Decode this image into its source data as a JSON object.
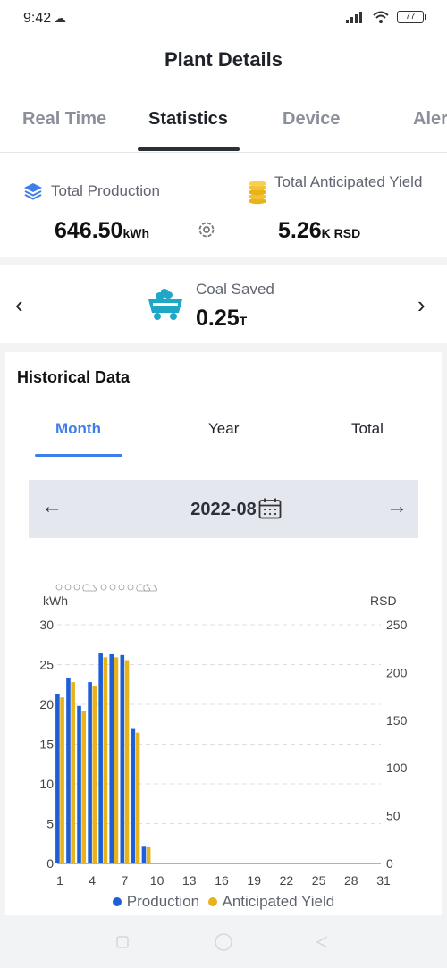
{
  "status": {
    "time": "9:42",
    "battery": "77"
  },
  "header": {
    "title": "Plant Details"
  },
  "tabs": [
    "Real Time",
    "Statistics",
    "Device",
    "Aler"
  ],
  "kpi": {
    "production": {
      "label": "Total Production",
      "value": "646.50",
      "unit": "kWh"
    },
    "yield": {
      "label": "Total Anticipated Yield",
      "value": "5.26",
      "unit": "K RSD"
    }
  },
  "coal": {
    "label": "Coal Saved",
    "value": "0.25",
    "unit": "T"
  },
  "historical": {
    "title": "Historical Data",
    "segments": [
      "Month",
      "Year",
      "Total"
    ],
    "date": "2022-08"
  },
  "colors": {
    "production": "#1f5fd6",
    "yield": "#e7b21a",
    "accent": "#3f7ee8"
  },
  "chart_data": {
    "type": "bar",
    "x": [
      1,
      2,
      3,
      4,
      5,
      6,
      7,
      8,
      9
    ],
    "x_ticks": [
      "1",
      "4",
      "7",
      "10",
      "13",
      "16",
      "19",
      "22",
      "25",
      "28",
      "31"
    ],
    "xlim": [
      1,
      31
    ],
    "left_axis": {
      "unit": "kWh",
      "ticks": [
        "0",
        "5",
        "10",
        "15",
        "20",
        "25",
        "30"
      ],
      "ylim": [
        0,
        30
      ]
    },
    "right_axis": {
      "unit": "RSD",
      "ticks": [
        "0",
        "50",
        "100",
        "150",
        "200",
        "250"
      ],
      "ylim": [
        0,
        250
      ]
    },
    "series": [
      {
        "name": "Production",
        "axis": "left",
        "values": [
          21.3,
          23.3,
          19.8,
          22.8,
          26.4,
          26.3,
          26.2,
          16.9,
          2.1
        ]
      },
      {
        "name": "Anticipated Yield",
        "axis": "right",
        "values": [
          174,
          190,
          160,
          186,
          216,
          216,
          213,
          137,
          17
        ]
      }
    ],
    "grid": true,
    "legend": "bottom"
  }
}
